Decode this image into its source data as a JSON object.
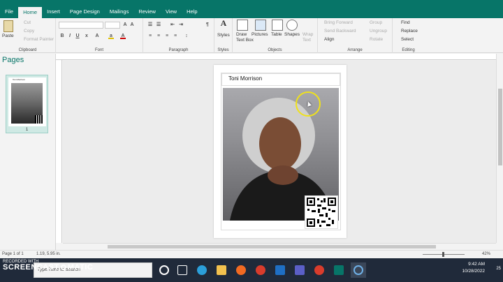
{
  "tabs": [
    "File",
    "Home",
    "Insert",
    "Page Design",
    "Mailings",
    "Review",
    "View",
    "Help"
  ],
  "active_tab": "Home",
  "ribbon": {
    "clipboard": {
      "paste": "Paste",
      "cut": "Cut",
      "copy": "Copy",
      "format_painter": "Format Painter",
      "label": "Clipboard"
    },
    "font": {
      "label": "Font"
    },
    "paragraph": {
      "label": "Paragraph"
    },
    "styles": {
      "styles_btn": "Styles",
      "label": "Styles"
    },
    "objects": {
      "draw_text_box": "Draw Text Box",
      "pictures": "Pictures",
      "table": "Table",
      "shapes": "Shapes",
      "wrap_text": "Wrap Text",
      "label": "Objects"
    },
    "arrange": {
      "bring_forward": "Bring Forward",
      "send_backward": "Send Backward",
      "align": "Align",
      "group": "Group",
      "ungroup": "Ungroup",
      "rotate": "Rotate",
      "label": "Arrange"
    },
    "editing": {
      "find": "Find",
      "replace": "Replace",
      "select": "Select",
      "label": "Editing"
    }
  },
  "pages_pane": {
    "title": "Pages",
    "thumbnail_number": "1",
    "thumb_title": "Toni Morrison"
  },
  "document": {
    "title_text": "Toni Morrison"
  },
  "status": {
    "page": "Page 1 of 1",
    "position": "1.19, 5.95 in.",
    "zoom": "42%"
  },
  "taskbar": {
    "search_placeholder": "Type here to search",
    "time": "9:42 AM",
    "date": "10/28/2022",
    "notification_count": "25"
  },
  "watermark": {
    "line1": "RECORDED WITH",
    "line2": "SCREENCAST",
    "line3": "MATIC"
  },
  "colors": {
    "brand": "#077568",
    "taskbar": "#202a3a",
    "highlight": "#f0e21a"
  }
}
